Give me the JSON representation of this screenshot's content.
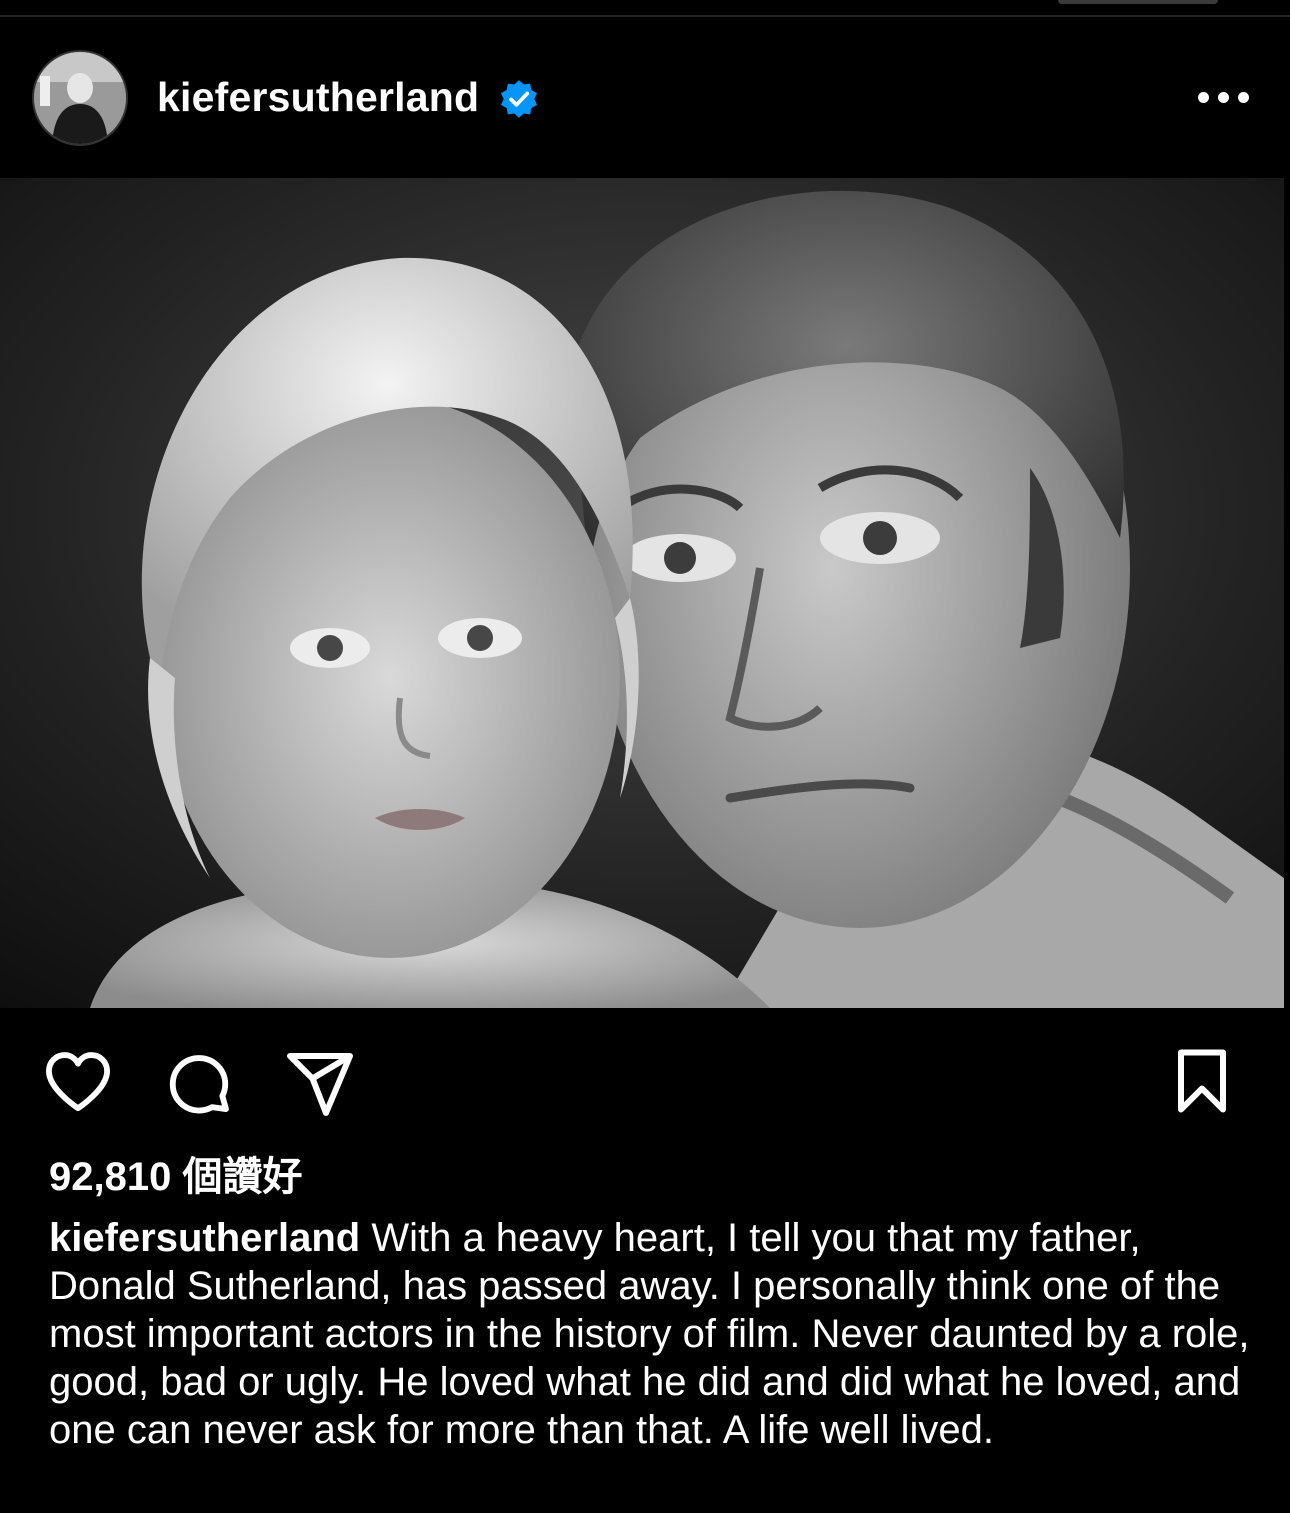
{
  "post": {
    "username": "kiefersutherland",
    "verified": true,
    "likes_text": "92,810 個讚好",
    "caption_username": "kiefersutherland",
    "caption_text": " With a heavy heart, I tell you that my father, Donald Sutherland, has passed away. I personally think one of the most important actors in the history of film. Never daunted by a role, good, bad or ugly. He loved what he did and did what he loved, and one can never ask for more than that. A life well lived."
  },
  "icons": {
    "verified": "verified-badge-icon",
    "more": "more-horizontal-icon",
    "like": "heart-icon",
    "comment": "comment-icon",
    "share": "share-icon",
    "save": "bookmark-icon"
  },
  "colors": {
    "background": "#000000",
    "text": "#ffffff",
    "verified_blue": "#0095f6"
  }
}
